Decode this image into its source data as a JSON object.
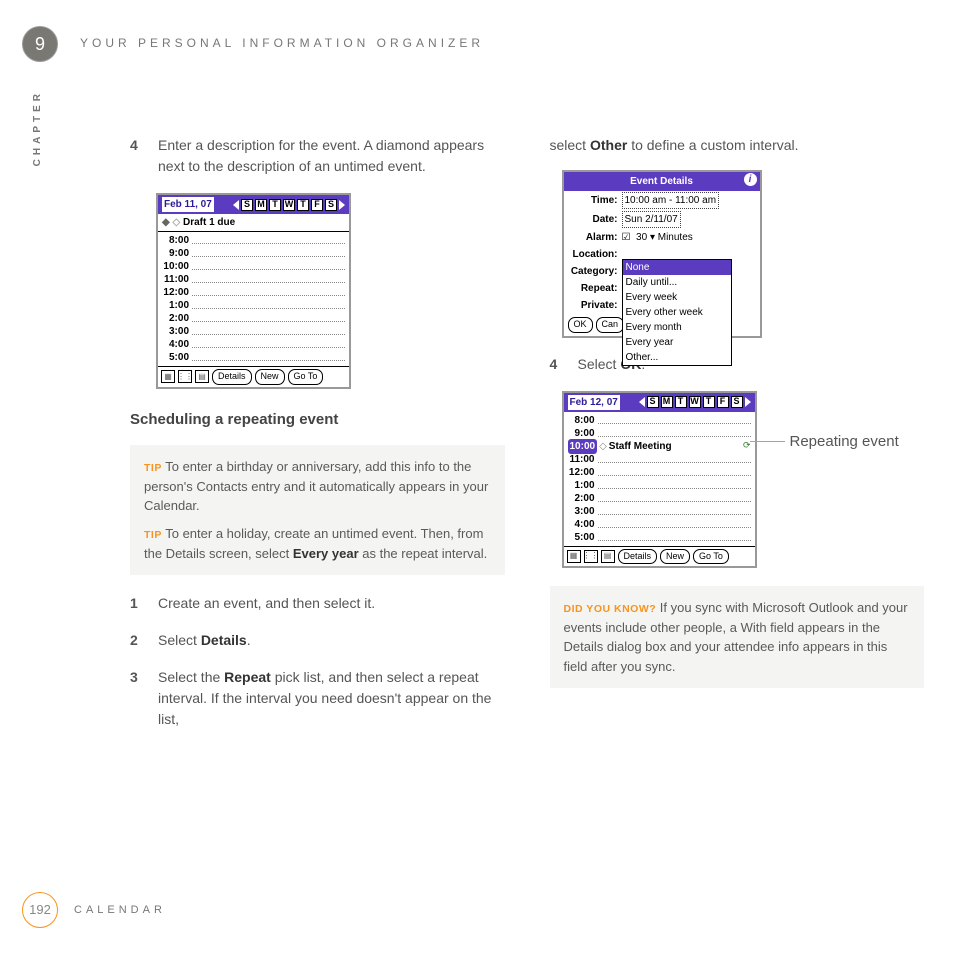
{
  "chapter_number": "9",
  "header_title": "YOUR PERSONAL INFORMATION ORGANIZER",
  "vertical_label": "CHAPTER",
  "left": {
    "step4_num": "4",
    "step4_text": "Enter a description for the event. A diamond appears next to the description of an untimed event.",
    "cal1": {
      "date": "Feb 11, 07",
      "days": [
        "S",
        "M",
        "T",
        "W",
        "T",
        "F",
        "S"
      ],
      "untimed": "Draft 1 due",
      "slots": [
        "8:00",
        "9:00",
        "10:00",
        "11:00",
        "12:00",
        "1:00",
        "2:00",
        "3:00",
        "4:00",
        "5:00"
      ],
      "btn_details": "Details",
      "btn_new": "New",
      "btn_goto": "Go To"
    },
    "section_heading": "Scheduling a repeating event",
    "tip_label": "TIP",
    "tip1": "To enter a birthday or anniversary, add this info to the person's Contacts entry and it automatically appears in your Calendar.",
    "tip2_a": "To enter a holiday, create an untimed event. Then, from the Details screen, select ",
    "tip2_b": "Every year",
    "tip2_c": " as the repeat interval.",
    "s1_num": "1",
    "s1_text": "Create an event, and then select it.",
    "s2_num": "2",
    "s2_a": "Select ",
    "s2_b": "Details",
    "s2_c": ".",
    "s3_num": "3",
    "s3_a": "Select the ",
    "s3_b": "Repeat",
    "s3_c": " pick list, and then select a repeat interval. If the interval you need doesn't appear on the list,"
  },
  "right": {
    "cont_a": "select ",
    "cont_b": "Other",
    "cont_c": " to define a custom interval.",
    "dlg": {
      "title": "Event Details",
      "time_lbl": "Time:",
      "time_val": "10:00 am - 11:00 am",
      "date_lbl": "Date:",
      "date_val": "Sun 2/11/07",
      "alarm_lbl": "Alarm:",
      "alarm_num": "30",
      "alarm_unit": "Minutes",
      "loc_lbl": "Location:",
      "cat_lbl": "Category:",
      "rep_lbl": "Repeat:",
      "priv_lbl": "Private:",
      "menu": [
        "None",
        "Daily until...",
        "Every week",
        "Every other week",
        "Every month",
        "Every year",
        "Other..."
      ],
      "ok": "OK",
      "can": "Can"
    },
    "s4_num": "4",
    "s4_a": "Select ",
    "s4_b": "OK",
    "s4_c": ".",
    "cal2": {
      "date": "Feb 12, 07",
      "days": [
        "S",
        "M",
        "T",
        "W",
        "T",
        "F",
        "S"
      ],
      "slots_before": [
        "8:00",
        "9:00"
      ],
      "hi_time": "10:00",
      "event": "Staff Meeting",
      "slots_after": [
        "11:00",
        "12:00",
        "1:00",
        "2:00",
        "3:00",
        "4:00",
        "5:00"
      ],
      "btn_details": "Details",
      "btn_new": "New",
      "btn_goto": "Go To"
    },
    "callout": "Repeating event",
    "dyk_label": "DID YOU KNOW?",
    "dyk_text": "If you sync with Microsoft Outlook and your events include other people, a With field appears in the Details dialog box and your attendee info appears in this field after you sync."
  },
  "page_num": "192",
  "footer_cat": "CALENDAR"
}
